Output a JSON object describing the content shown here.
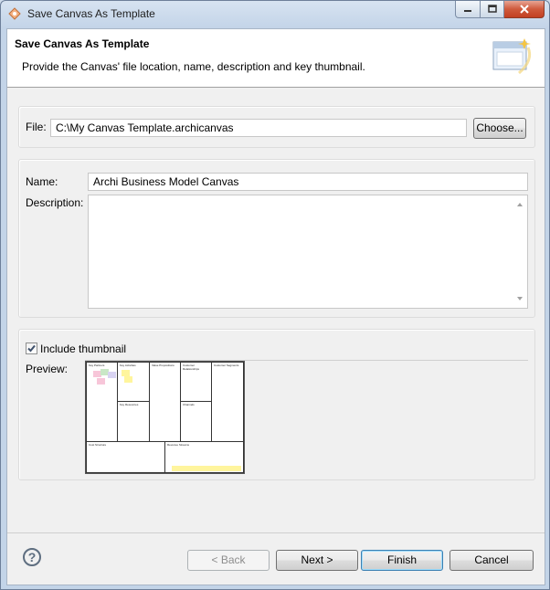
{
  "window": {
    "title": "Save Canvas As Template"
  },
  "banner": {
    "title": "Save Canvas As Template",
    "description": "Provide the Canvas' file location, name, description and key thumbnail."
  },
  "file": {
    "label": "File:",
    "value": "C:\\My Canvas Template.archicanvas",
    "choose_label": "Choose..."
  },
  "name": {
    "label": "Name:",
    "value": "Archi Business Model Canvas"
  },
  "description": {
    "label": "Description:",
    "value": ""
  },
  "thumbnail": {
    "include_label": "Include thumbnail",
    "checked": true,
    "preview_label": "Preview:"
  },
  "buttons": {
    "back": "< Back",
    "next": "Next >",
    "finish": "Finish",
    "cancel": "Cancel"
  },
  "icons": {
    "help": "help-icon",
    "app": "archi-app-icon",
    "wizard": "wizard-banner-icon"
  },
  "colors": {
    "accent": "#3c7fb1",
    "close": "#c24021"
  }
}
